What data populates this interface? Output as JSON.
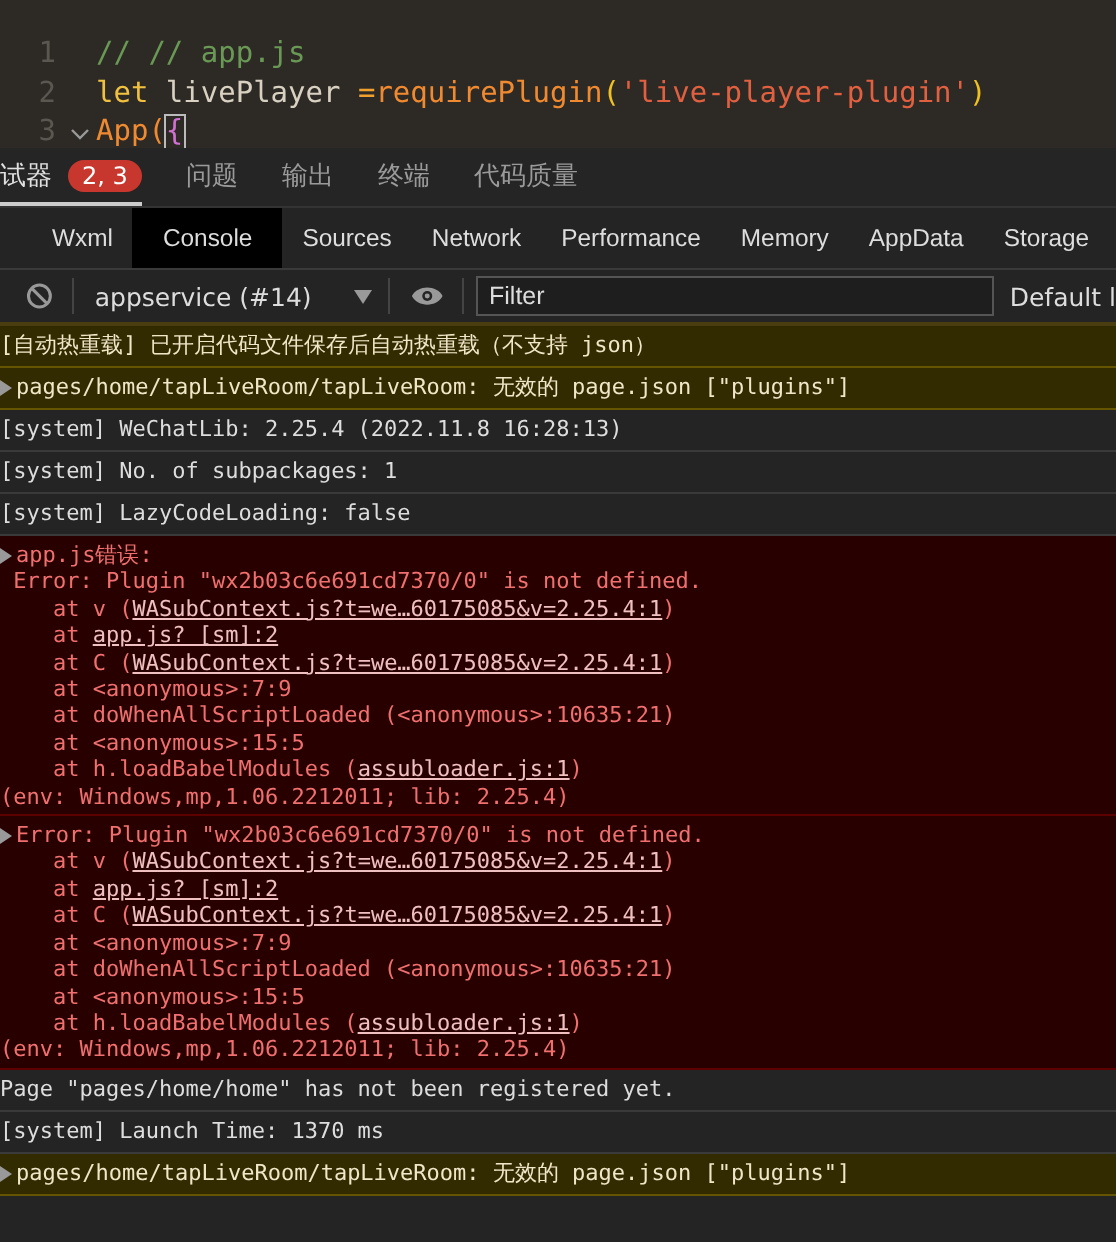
{
  "editor": {
    "lines": [
      {
        "number": "1",
        "foldable": false,
        "tokens": [
          {
            "text": "// // app.js",
            "kind": "comment"
          }
        ]
      },
      {
        "number": "2",
        "foldable": false,
        "tokens": [
          {
            "text": "let ",
            "kind": "keyword"
          },
          {
            "text": "livePlayer ",
            "kind": "variable"
          },
          {
            "text": "=",
            "kind": "operator"
          },
          {
            "text": "requirePlugin",
            "kind": "function"
          },
          {
            "text": "(",
            "kind": "bracket"
          },
          {
            "text": "'live-player-plugin'",
            "kind": "string"
          },
          {
            "text": ")",
            "kind": "bracket"
          }
        ]
      },
      {
        "number": "3",
        "foldable": true,
        "tokens": [
          {
            "text": "App(",
            "kind": "function"
          },
          {
            "text": "{",
            "kind": "cursor-brace"
          }
        ]
      }
    ]
  },
  "panel_tabs": [
    {
      "label": "试器",
      "selected": true,
      "badge": "2, 3"
    },
    {
      "label": "问题",
      "selected": false
    },
    {
      "label": "输出",
      "selected": false
    },
    {
      "label": "终端",
      "selected": false
    },
    {
      "label": "代码质量",
      "selected": false
    }
  ],
  "devtools_tabs": [
    {
      "label": "Wxml",
      "selected": false
    },
    {
      "label": "Console",
      "selected": true
    },
    {
      "label": "Sources",
      "selected": false
    },
    {
      "label": "Network",
      "selected": false
    },
    {
      "label": "Performance",
      "selected": false
    },
    {
      "label": "Memory",
      "selected": false
    },
    {
      "label": "AppData",
      "selected": false
    },
    {
      "label": "Storage",
      "selected": false
    }
  ],
  "console_toolbar": {
    "context": "appservice (#14)",
    "filter": {
      "placeholder": "Filter"
    },
    "levels": "Default l"
  },
  "messages": [
    {
      "kind": "warning",
      "expandable": false,
      "lines": [
        [
          {
            "text": "[自动热重载] 已开启代码文件保存后自动热重载（不支持 json）",
            "link": false
          }
        ]
      ]
    },
    {
      "kind": "warning",
      "expandable": true,
      "lines": [
        [
          {
            "text": "pages/home/tapLiveRoom/tapLiveRoom: 无效的 page.json [\"plugins\"]",
            "link": false
          }
        ]
      ]
    },
    {
      "kind": "info",
      "expandable": false,
      "lines": [
        [
          {
            "text": "[system] WeChatLib: 2.25.4 (2022.11.8 16:28:13)",
            "link": false
          }
        ]
      ]
    },
    {
      "kind": "info",
      "expandable": false,
      "lines": [
        [
          {
            "text": "[system] No. of subpackages: 1",
            "link": false
          }
        ]
      ]
    },
    {
      "kind": "info",
      "expandable": false,
      "lines": [
        [
          {
            "text": "[system] LazyCodeLoading: false",
            "link": false
          }
        ]
      ]
    },
    {
      "kind": "error",
      "expandable": true,
      "lines": [
        [
          {
            "text": "app.js错误:",
            "link": false
          }
        ],
        [
          {
            "text": " Error: Plugin \"wx2b03c6e691cd7370/0\" is not defined.",
            "link": false
          }
        ],
        [
          {
            "text": "    at v (",
            "link": false
          },
          {
            "text": "WASubContext.js?t=we…60175085&v=2.25.4:1",
            "link": true
          },
          {
            "text": ")",
            "link": false
          }
        ],
        [
          {
            "text": "    at ",
            "link": false
          },
          {
            "text": "app.js? [sm]:2",
            "link": true
          }
        ],
        [
          {
            "text": "    at C (",
            "link": false
          },
          {
            "text": "WASubContext.js?t=we…60175085&v=2.25.4:1",
            "link": true
          },
          {
            "text": ")",
            "link": false
          }
        ],
        [
          {
            "text": "    at <anonymous>:7:9",
            "link": false
          }
        ],
        [
          {
            "text": "    at doWhenAllScriptLoaded (<anonymous>:10635:21)",
            "link": false
          }
        ],
        [
          {
            "text": "    at <anonymous>:15:5",
            "link": false
          }
        ],
        [
          {
            "text": "    at h.loadBabelModules (",
            "link": false
          },
          {
            "text": "assubloader.js:1",
            "link": true
          },
          {
            "text": ")",
            "link": false
          }
        ],
        [
          {
            "text": "(env: Windows,mp,1.06.2212011; lib: 2.25.4)",
            "link": false
          }
        ]
      ]
    },
    {
      "kind": "error",
      "expandable": true,
      "lines": [
        [
          {
            "text": "Error: Plugin \"wx2b03c6e691cd7370/0\" is not defined.",
            "link": false
          }
        ],
        [
          {
            "text": "    at v (",
            "link": false
          },
          {
            "text": "WASubContext.js?t=we…60175085&v=2.25.4:1",
            "link": true
          },
          {
            "text": ")",
            "link": false
          }
        ],
        [
          {
            "text": "    at ",
            "link": false
          },
          {
            "text": "app.js? [sm]:2",
            "link": true
          }
        ],
        [
          {
            "text": "    at C (",
            "link": false
          },
          {
            "text": "WASubContext.js?t=we…60175085&v=2.25.4:1",
            "link": true
          },
          {
            "text": ")",
            "link": false
          }
        ],
        [
          {
            "text": "    at <anonymous>:7:9",
            "link": false
          }
        ],
        [
          {
            "text": "    at doWhenAllScriptLoaded (<anonymous>:10635:21)",
            "link": false
          }
        ],
        [
          {
            "text": "    at <anonymous>:15:5",
            "link": false
          }
        ],
        [
          {
            "text": "    at h.loadBabelModules (",
            "link": false
          },
          {
            "text": "assubloader.js:1",
            "link": true
          },
          {
            "text": ")",
            "link": false
          }
        ],
        [
          {
            "text": "(env: Windows,mp,1.06.2212011; lib: 2.25.4)",
            "link": false
          }
        ]
      ]
    },
    {
      "kind": "info",
      "expandable": false,
      "lines": [
        [
          {
            "text": "Page \"pages/home/home\" has not been registered yet.",
            "link": false
          }
        ]
      ]
    },
    {
      "kind": "info",
      "expandable": false,
      "lines": [
        [
          {
            "text": "[system] Launch Time: 1370 ms",
            "link": false
          }
        ]
      ]
    },
    {
      "kind": "warning",
      "expandable": true,
      "lines": [
        [
          {
            "text": "pages/home/tapLiveRoom/tapLiveRoom: 无效的 page.json [\"plugins\"]",
            "link": false
          }
        ]
      ]
    }
  ]
}
